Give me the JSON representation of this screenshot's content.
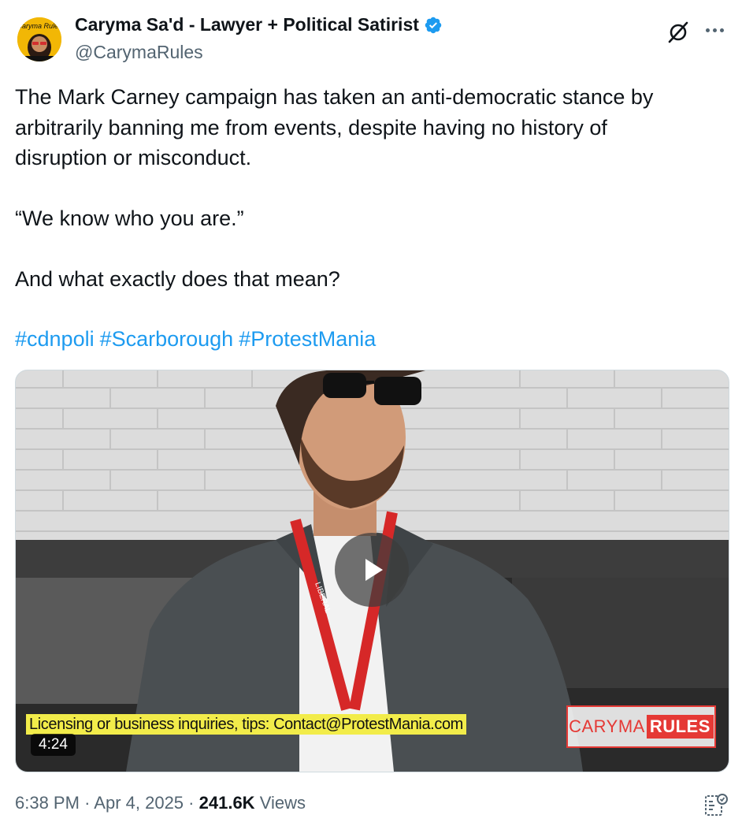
{
  "author": {
    "display_name": "Caryma Sa'd - Lawyer + Political Satirist",
    "handle": "@CarymaRules",
    "avatar_text": "Caryma Rules",
    "verified": true
  },
  "tweet": {
    "text": "The Mark Carney campaign has taken an anti-democratic stance by\narbitrarily banning me from events, despite having no history of\ndisruption or misconduct.\n\n“We know who you are.”\n\nAnd what exactly does that mean?",
    "hashtags": [
      "#cdnpoli",
      "#Scarborough",
      "#ProtestMania"
    ]
  },
  "media": {
    "type": "video",
    "duration": "4:24",
    "caption_overlay": "Licensing or business inquiries, tips: Contact@ProtestMania.com",
    "watermark_part1": "CARYMA",
    "watermark_part2": "RULES",
    "lanyard_text": "LIBERAL"
  },
  "meta": {
    "time": "6:38 PM",
    "separator1": "·",
    "date": "Apr 4, 2025",
    "separator2": "·",
    "views_count": "241.6K",
    "views_label": "Views"
  },
  "icons": {
    "verified": "verified-badge-icon",
    "grok": "grok-icon",
    "more": "more-options-icon",
    "play": "play-icon",
    "analytics": "analytics-icon"
  },
  "colors": {
    "link": "#1d9bf0",
    "secondary_text": "#536471",
    "primary_text": "#0f1419",
    "verified_blue": "#1d9bf0",
    "caption_yellow": "#f2ec4a",
    "watermark_red": "#e53935"
  }
}
